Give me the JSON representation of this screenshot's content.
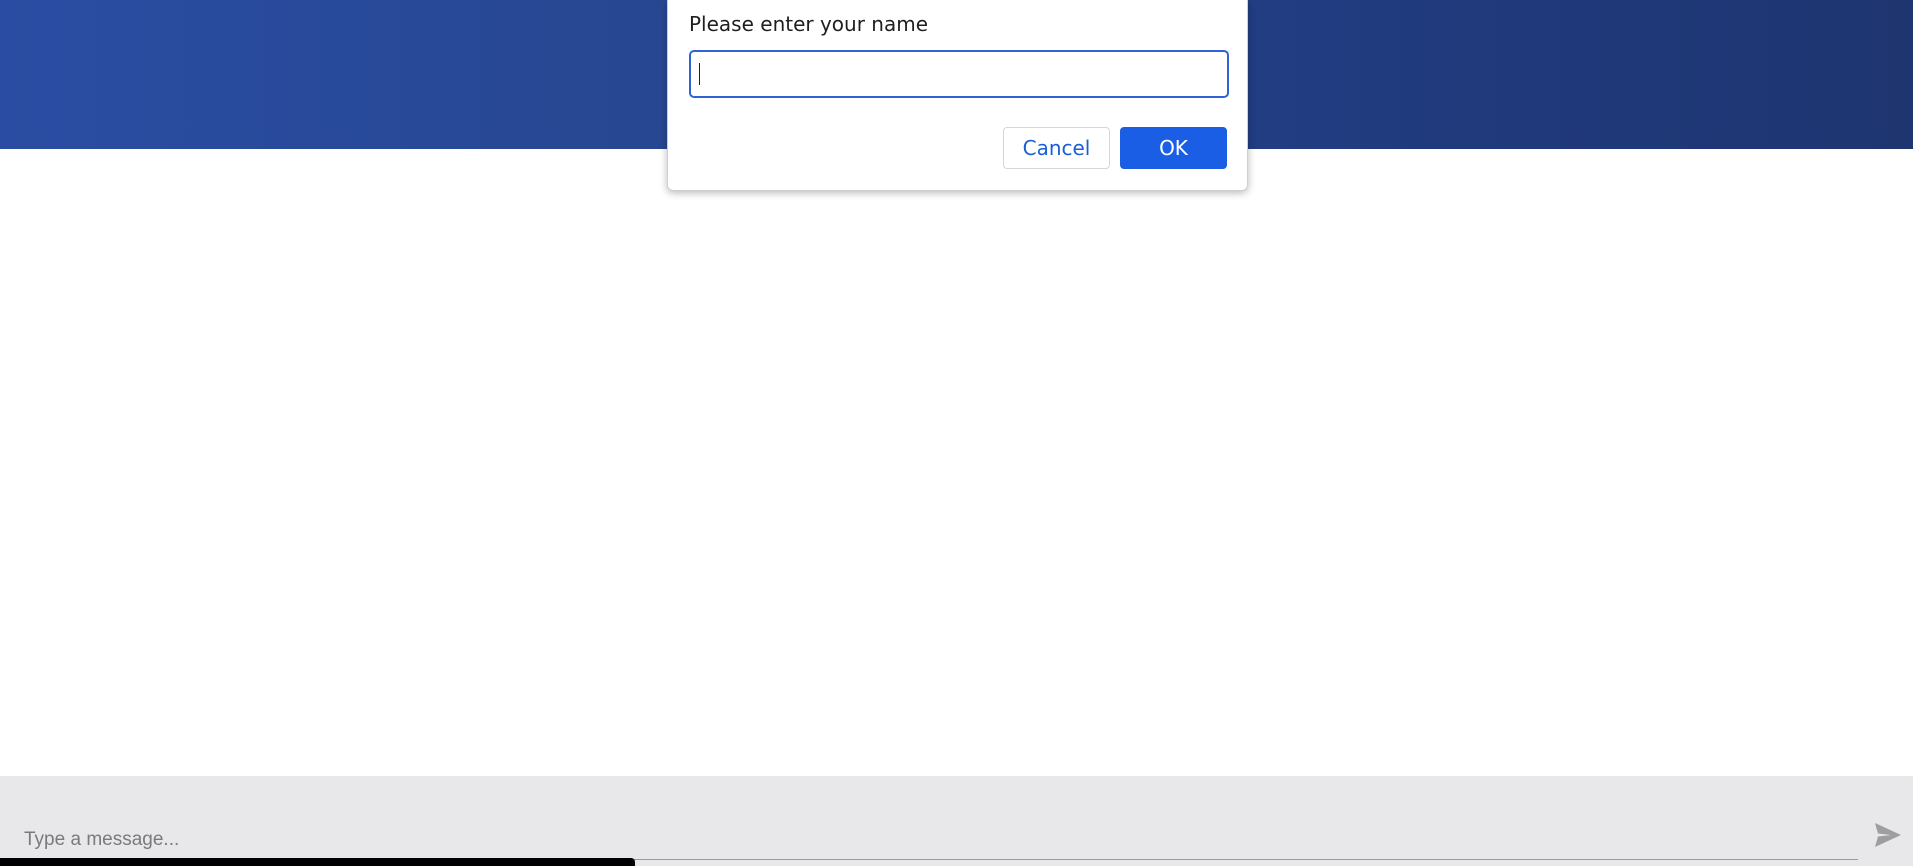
{
  "header": {
    "background_gradient": [
      "#2a4da3",
      "#1e3570"
    ]
  },
  "composer": {
    "placeholder": "Type a message...",
    "send_icon": "send-icon",
    "background": "#e8e8ea"
  },
  "dialog": {
    "message": "Please enter your name",
    "input_value": "",
    "cancel_label": "Cancel",
    "ok_label": "OK",
    "accent": "#1a5ee6"
  }
}
